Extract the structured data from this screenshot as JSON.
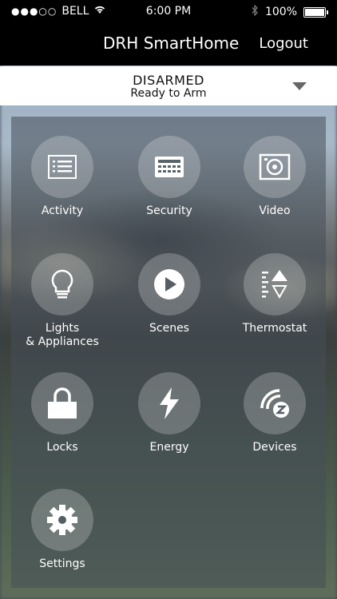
{
  "status_bar": {
    "carrier": "BELL",
    "time": "6:00 PM",
    "battery": "100%"
  },
  "header": {
    "title": "DRH SmartHome",
    "logout_label": "Logout"
  },
  "security_status": {
    "state": "DISARMED",
    "subtitle": "Ready to Arm"
  },
  "tiles": [
    {
      "label": "Activity",
      "icon": "list-icon"
    },
    {
      "label": "Security",
      "icon": "keypad-icon"
    },
    {
      "label": "Video",
      "icon": "camera-icon"
    },
    {
      "label": "Lights\n& Appliances",
      "label_line1": "Lights",
      "label_line2": "& Appliances",
      "icon": "lightbulb-icon"
    },
    {
      "label": "Scenes",
      "icon": "play-icon"
    },
    {
      "label": "Thermostat",
      "icon": "thermostat-icon"
    },
    {
      "label": "Locks",
      "icon": "lock-icon"
    },
    {
      "label": "Energy",
      "icon": "lightning-icon"
    },
    {
      "label": "Devices",
      "icon": "zwave-icon"
    },
    {
      "label": "Settings",
      "icon": "gear-icon"
    }
  ]
}
